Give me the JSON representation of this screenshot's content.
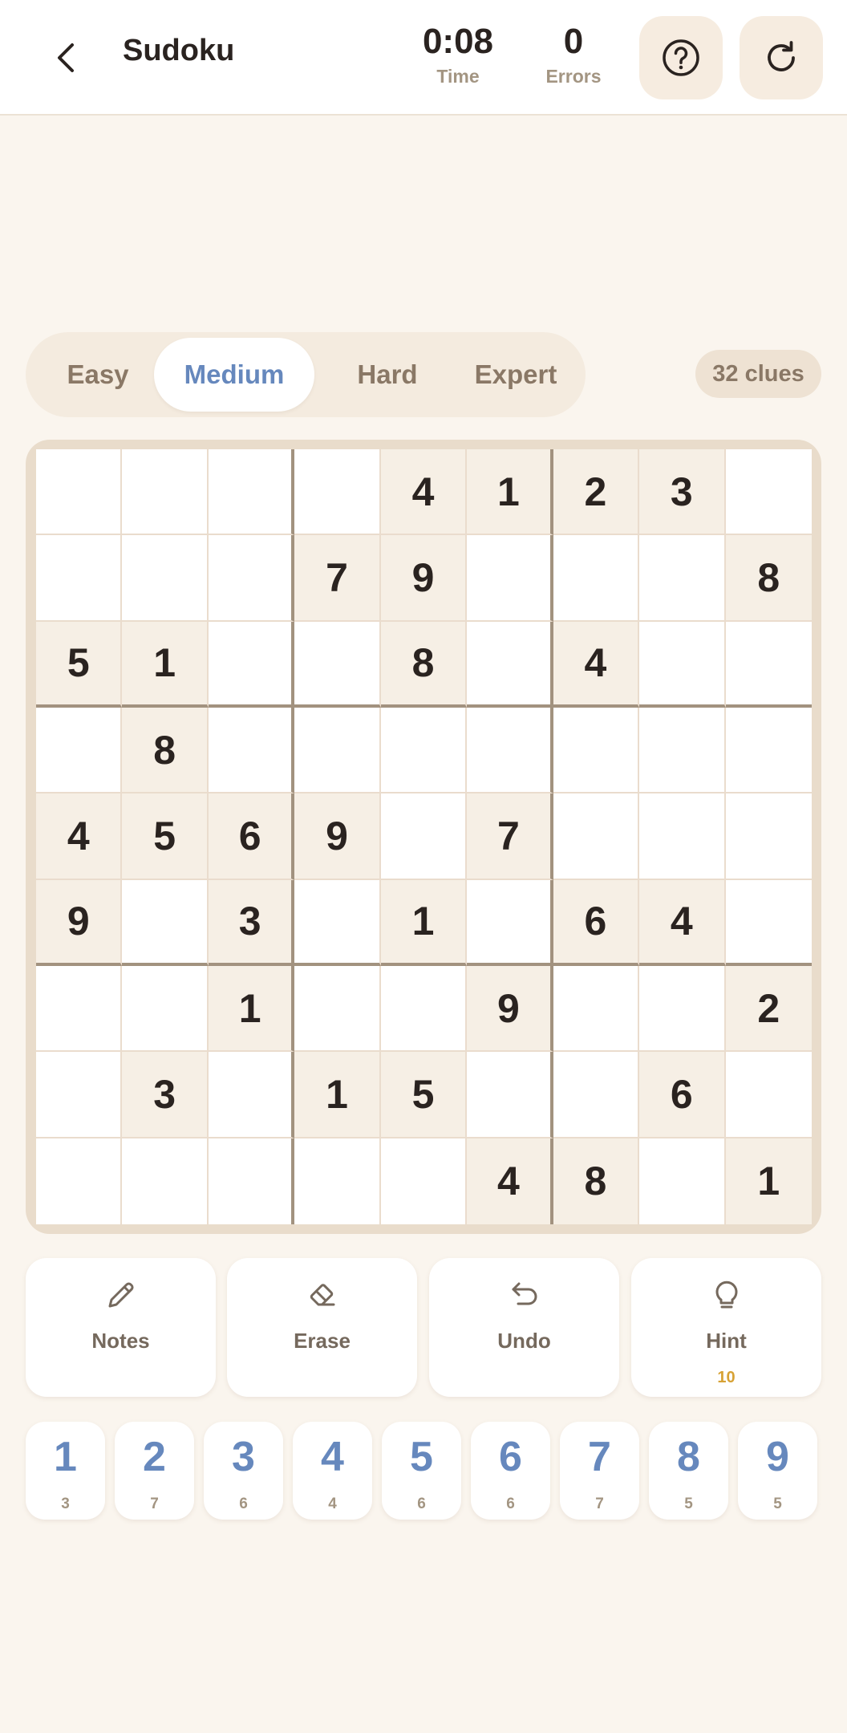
{
  "header": {
    "title": "Sudoku",
    "time_value": "0:08",
    "time_label": "Time",
    "errors_value": "0",
    "errors_label": "Errors",
    "icons": {
      "back": "chevron-left-icon",
      "help": "question-circle-icon",
      "restart": "refresh-icon"
    }
  },
  "difficulty": {
    "tabs": [
      {
        "label": "Easy",
        "active": false
      },
      {
        "label": "Medium",
        "active": true
      },
      {
        "label": "Hard",
        "active": false
      },
      {
        "label": "Expert",
        "active": false
      }
    ],
    "clues_label": "32 clues"
  },
  "board": [
    [
      "",
      "",
      "",
      "",
      "4",
      "1",
      "2",
      "3",
      ""
    ],
    [
      "",
      "",
      "",
      "7",
      "9",
      "",
      "",
      "",
      "8"
    ],
    [
      "5",
      "1",
      "",
      "",
      "8",
      "",
      "4",
      "",
      ""
    ],
    [
      "",
      "8",
      "",
      "",
      "",
      "",
      "",
      "",
      ""
    ],
    [
      "4",
      "5",
      "6",
      "9",
      "",
      "7",
      "",
      "",
      ""
    ],
    [
      "9",
      "",
      "3",
      "",
      "1",
      "",
      "6",
      "4",
      ""
    ],
    [
      "",
      "",
      "1",
      "",
      "",
      "9",
      "",
      "",
      "2"
    ],
    [
      "",
      "3",
      "",
      "1",
      "5",
      "",
      "",
      "6",
      ""
    ],
    [
      "",
      "",
      "",
      "",
      "",
      "4",
      "8",
      "",
      "1"
    ]
  ],
  "actions": [
    {
      "label": "Notes",
      "icon": "pencil-icon",
      "count": ""
    },
    {
      "label": "Erase",
      "icon": "eraser-icon",
      "count": ""
    },
    {
      "label": "Undo",
      "icon": "undo-icon",
      "count": ""
    },
    {
      "label": "Hint",
      "icon": "lightbulb-icon",
      "count": "10"
    }
  ],
  "numpad": [
    {
      "digit": "1",
      "remaining": "3"
    },
    {
      "digit": "2",
      "remaining": "7"
    },
    {
      "digit": "3",
      "remaining": "6"
    },
    {
      "digit": "4",
      "remaining": "4"
    },
    {
      "digit": "5",
      "remaining": "6"
    },
    {
      "digit": "6",
      "remaining": "6"
    },
    {
      "digit": "7",
      "remaining": "7"
    },
    {
      "digit": "8",
      "remaining": "5"
    },
    {
      "digit": "9",
      "remaining": "5"
    }
  ],
  "colors": {
    "background": "#faf5ee",
    "accent_blue": "#6688bd",
    "hint_count": "#d7a235",
    "given_cell": "#f6efe5",
    "text_dark": "#2a2320"
  }
}
